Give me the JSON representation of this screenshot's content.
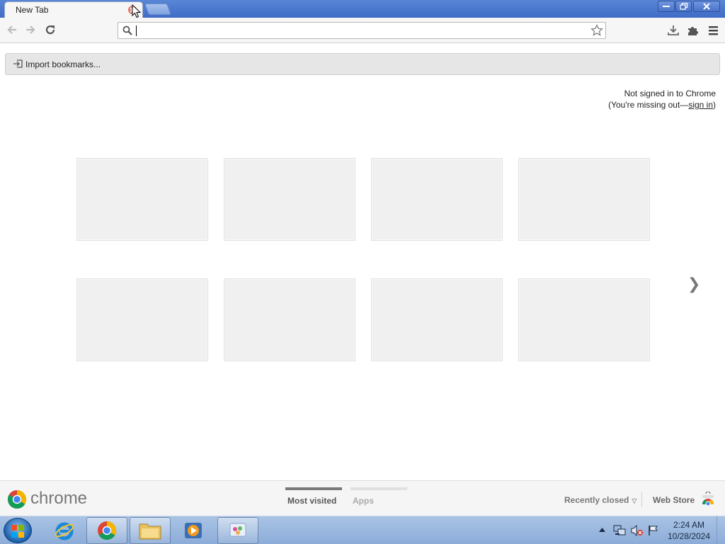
{
  "tab": {
    "title": "New Tab"
  },
  "omnibox": {
    "value": "",
    "placeholder": ""
  },
  "bookmark_prompt": {
    "label": "Import bookmarks..."
  },
  "signin": {
    "line1": "Not signed in to Chrome",
    "line2_prefix": "(You're missing out—",
    "link": "sign in",
    "line2_suffix": ")"
  },
  "tiles": {
    "count": 8
  },
  "next_arrow": "❯",
  "footer": {
    "logo_text": "chrome",
    "tabs": [
      {
        "label": "Most visited",
        "selected": true
      },
      {
        "label": "Apps",
        "selected": false
      }
    ],
    "recently_closed": "Recently closed",
    "web_store": "Web Store"
  },
  "taskbar": {
    "time": "2:24 AM",
    "date": "10/28/2024"
  },
  "colors": {
    "titlebar": "#4a78cc",
    "tile_bg": "#f0f0f0",
    "selected_tab_bar": "#7a7a7a",
    "unselected_tab_bar": "#e0e0e0"
  }
}
